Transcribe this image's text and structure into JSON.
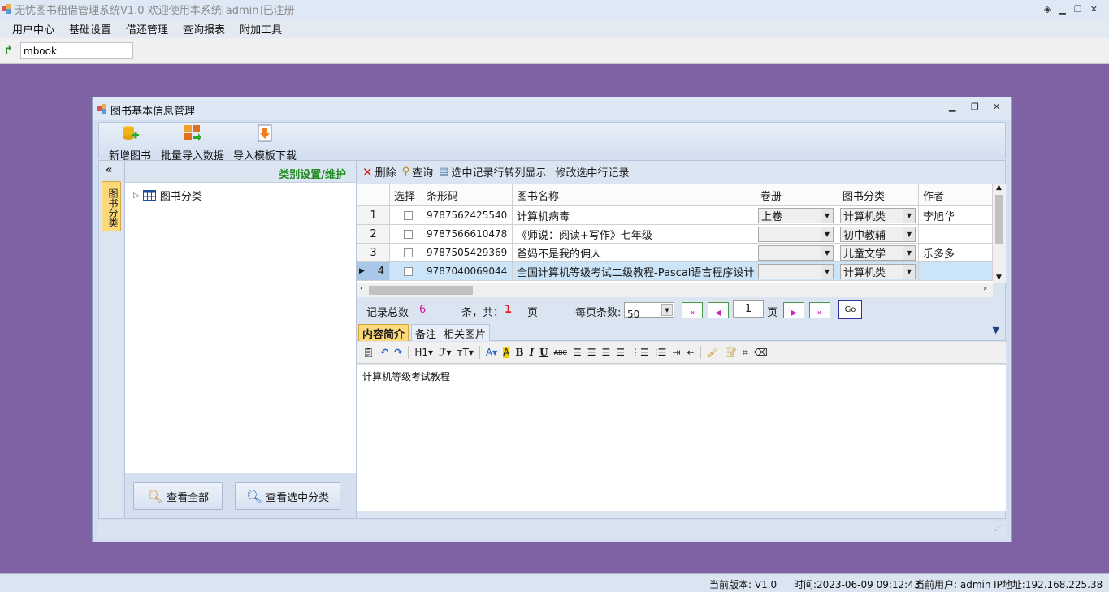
{
  "app": {
    "title": "无忧图书租借管理系统V1.0  欢迎使用本系统[admin]已注册",
    "menu": [
      "用户中心",
      "基础设置",
      "借还管理",
      "查询报表",
      "附加工具"
    ],
    "address_value": "mbook"
  },
  "status": {
    "version": "当前版本: V1.0",
    "time": "时间:2023-06-09 09:12:43",
    "user": "当前用户: admin",
    "ip": "IP地址:192.168.225.38"
  },
  "window": {
    "title": "图书基本信息管理",
    "toolbar": {
      "new_book": "新增图书",
      "batch_import": "批量导入数据",
      "template_download": "导入模板下载"
    },
    "category_tab": "图书分类",
    "category_header": "类别设置/维护",
    "tree_root": "图书分类",
    "view_all": "查看全部",
    "view_selected": "查看选中分类",
    "actions": {
      "delete": "删除",
      "query": "查询",
      "row_to_column": "选中记录行转列显示",
      "edit_row": "修改选中行记录"
    },
    "grid": {
      "headers": [
        "选择",
        "条形码",
        "图书名称",
        "卷册",
        "图书分类",
        "作者"
      ],
      "rows": [
        {
          "no": "1",
          "barcode": "9787562425540",
          "name": "计算机病毒",
          "volume": "上卷",
          "category": "计算机类",
          "author": "李旭华"
        },
        {
          "no": "2",
          "barcode": "9787566610478",
          "name": "《师说：阅读+写作》七年级",
          "volume": "",
          "category": "初中教辅",
          "author": ""
        },
        {
          "no": "3",
          "barcode": "9787505429369",
          "name": "爸妈不是我的佣人",
          "volume": "",
          "category": "儿童文学",
          "author": "乐多多"
        },
        {
          "no": "4",
          "barcode": "9787040069044",
          "name": "全国计算机等级考试二级教程-Pascal语言程序设计",
          "volume": "",
          "category": "计算机类",
          "author": ""
        }
      ]
    },
    "pager": {
      "total_label": "记录总数",
      "total_count": "6",
      "unit_label": "条，共：",
      "pages": "1",
      "page_unit": "页",
      "per_page_label": "每页条数:",
      "per_page": "50",
      "current_page": "1",
      "page_label": "页",
      "go": "Go"
    },
    "tabs": [
      "内容简介",
      "备注",
      "相关图片"
    ],
    "editor_content": "计算机等级考试教程"
  },
  "colors": {
    "desktop": "#7e62a3",
    "accent_tab": "#fbd87a",
    "green_header": "#1d8a1d",
    "total_count": "#c8189a",
    "pages_count": "#e02020"
  }
}
